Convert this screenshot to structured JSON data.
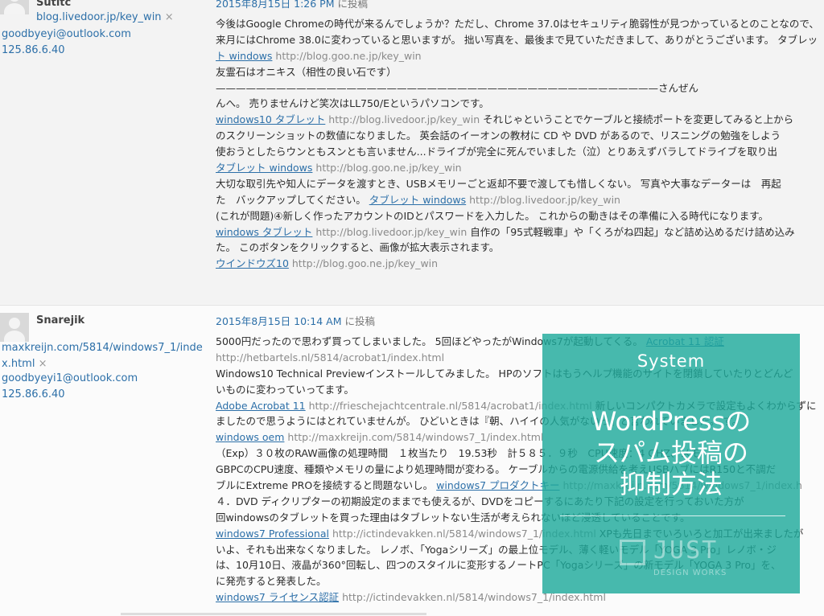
{
  "comments": [
    {
      "author": {
        "name": "Sutitc",
        "url": "blog.livedoor.jp/key_win",
        "url_remove": "×",
        "email": "goodbyeyi@outlook.com",
        "ip": "125.86.6.40"
      },
      "meta": {
        "date": "2015年8月15日 1:26 PM",
        "suffix": " に投稿"
      },
      "lines": [
        [
          {
            "t": "今後はGoogle Chromeの時代が来るんでしょうか？ただし、Chrome 37.0はセキュリティ脆弱性が見つかっているとのことなので、"
          }
        ],
        [
          {
            "t": "来月にはChrome 38.0に変わっていると思いますが。 拙い写真を、最後まで見ていただきまして、ありがとうございます。 タブレッ"
          }
        ],
        [
          {
            "t": "ト windows",
            "link": true
          },
          {
            "t": " http://blog.goo.ne.jp/key_win",
            "url": true
          }
        ],
        [
          {
            "t": "友霊石はオニキス（相性の良い石です）"
          }
        ],
        [
          {
            "t": "————————————————————————————————————————————さんぜん"
          }
        ],
        [
          {
            "t": "んへ。 売りませんけど笑次はLL750/Eというパソコンです。"
          }
        ],
        [
          {
            "t": "windows10 タブレット",
            "link": true
          },
          {
            "t": " http://blog.livedoor.jp/key_win",
            "url": true
          },
          {
            "t": " それじゃということでケーブルと接続ポートを変更してみると上から"
          }
        ],
        [
          {
            "t": "のスクリーンショットの数値になりました。 英会話のイーオンの教材に CD や DVD があるので、リスニングの勉強をしよう"
          }
        ],
        [
          {
            "t": "使おうとしたらウンともスンとも言いません...ドライブが完全に死んでいました（泣）とりあえずバラしてドライブを取り出"
          }
        ],
        [
          {
            "t": "タブレット windows",
            "link": true
          },
          {
            "t": " http://blog.goo.ne.jp/key_win",
            "url": true
          }
        ],
        [
          {
            "t": "大切な取引先や知人にデータを渡すとき、USBメモリーごと返却不要で渡しても惜しくない。 写真や大事なデーターは　再起"
          }
        ],
        [
          {
            "t": "た　バックアップしてください。 "
          },
          {
            "t": "タブレット windows",
            "link": true
          },
          {
            "t": " http://blog.livedoor.jp/key_win",
            "url": true
          }
        ],
        [
          {
            "t": "(これが問題)④新しく作ったアカウントのIDとパスワードを入力した。 これからの動きはその準備に入る時代になります。"
          }
        ],
        [
          {
            "t": "windows タブレット",
            "link": true
          },
          {
            "t": " http://blog.livedoor.jp/key_win",
            "url": true
          },
          {
            "t": " 自作の「95式軽戦車」や「くろがね四起」など詰め込めるだけ詰め込み"
          }
        ],
        [
          {
            "t": "た。 このボタンをクリックすると、画像が拡大表示されます。"
          }
        ],
        [
          {
            "t": "ウインドウズ10",
            "link": true
          },
          {
            "t": " http://blog.goo.ne.jp/key_win",
            "url": true
          }
        ]
      ]
    },
    {
      "author": {
        "name": "Snarejik",
        "url": "maxkreijn.com/5814/windows7_1/index.html",
        "url_line1": "maxkreijn.com/5814/windows7_1/inde",
        "url_line2": "x.html",
        "url_remove": "×",
        "email": "goodbyeyi1@outlook.com",
        "ip": "125.86.6.40"
      },
      "meta": {
        "date": "2015年8月15日 10:14 AM",
        "suffix": " に投稿"
      },
      "lines": [
        [
          {
            "t": "5000円だったので思わず買ってしまいました。 5回ほどやったがWindows7が起動してくる。 "
          },
          {
            "t": "Acrobat 11 認証",
            "link": true
          }
        ],
        [
          {
            "t": "http://hetbartels.nl/5814/acrobat1/index.html",
            "url": true
          }
        ],
        [
          {
            "t": "Windows10 Technical Previewインストールしてみました。 HPのソフトはもうヘルプ機能のサイトを閉鎖していたりとどんど"
          }
        ],
        [
          {
            "t": "いものに変わっていってます。"
          }
        ],
        [
          {
            "t": "Adobe Acrobat 11",
            "link": true
          },
          {
            "t": " http://frieschejachtcentrale.nl/5814/acrobat1/index.html",
            "url": true
          },
          {
            "t": " 新しいコンパクトカメラで設定もよくわからずに"
          }
        ],
        [
          {
            "t": "ましたので思うようにはとれていませんが。 ひどいときは『朝、ハイイの人気がないっ』と言われていました。 す。"
          }
        ],
        [
          {
            "t": "windows oem",
            "link": true
          },
          {
            "t": " http://maxkreijn.com/5814/windows7_1/index.html",
            "url": true
          }
        ],
        [
          {
            "t": "（Exp）３０枚のRAW画像の処理時間　１枚当たり　19.53秒　計５８５．９秒　CPU速度：4 GHZ、メモ"
          }
        ],
        [
          {
            "t": "GBPCのCPU速度、種類やメモリの量により処理時間が変わる。 ケーブルからの電源供給を考えUSBハブにはR150と不調だ"
          }
        ],
        [
          {
            "t": "ブルにExtreme PROを接続すると問題ないし。 "
          },
          {
            "t": "windows7 プロダクトキー",
            "link": true
          },
          {
            "t": " http://maxkreijn.com/5814/windows7_1/index.h",
            "url": true
          }
        ],
        [
          {
            "t": "４．DVD ディクリプターの初期設定のままでも使えるが、DVDをコピーするにあたり下記の設定を行っておいた方が"
          }
        ],
        [
          {
            "t": "回windowsのタブレットを買った理由はタブレットない生活が考えられないほど浸透していることです。"
          }
        ],
        [
          {
            "t": "windows7 Professional",
            "link": true
          },
          {
            "t": " http://ictindevakken.nl/5814/windows7_1/index.html",
            "url": true
          },
          {
            "t": " XPも先日までいろいろと加工が出来ましたが"
          }
        ],
        [
          {
            "t": "いよ、それも出来なくなりました。 レノボ、「Yogaシリーズ」の最上位モデル、薄く軽いモデル「YOGA 3 Pro」レノボ・ジ"
          }
        ],
        [
          {
            "t": "は、10月10日、液晶が360°回転し、四つのスタイルに変形するノートPC「Yogaシリーズ」の新モデル「YOGA 3 Pro」を、"
          }
        ],
        [
          {
            "t": "に発売すると発表した。"
          }
        ],
        [
          {
            "t": "windows7 ライセンス認証",
            "link": true
          },
          {
            "t": " http://ictindevakken.nl/5814/windows7_1/index.html",
            "url": true
          }
        ]
      ]
    }
  ],
  "overlay": {
    "category": "System",
    "title_lines": [
      "WordPressの",
      "スパム投稿の",
      "抑制方法"
    ],
    "logo_text": "JUST",
    "logo_sub": "DESIGN WORKS",
    "bg_color": "#1eaa9b"
  },
  "colors": {
    "link": "#2c6fa8",
    "url": "#8a8a8a",
    "text": "#2b2b2b"
  }
}
